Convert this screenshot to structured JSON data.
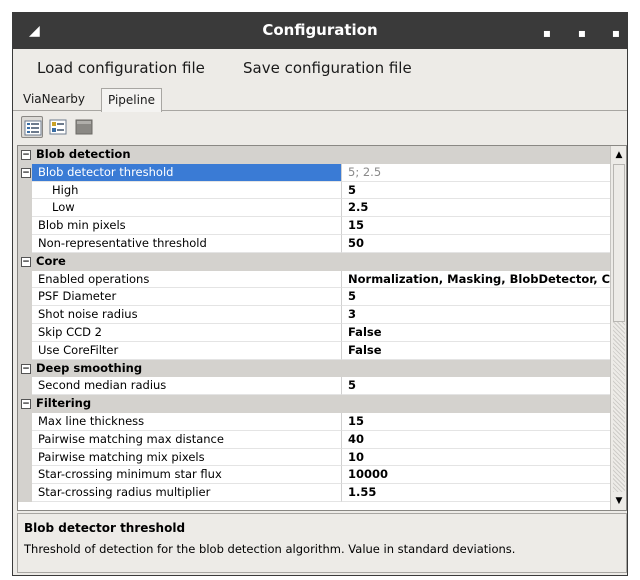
{
  "window": {
    "title": "Configuration",
    "menu_glyph": "◢",
    "min_glyph": "▪",
    "max_glyph": "▪",
    "close_glyph": "▪"
  },
  "menubar": {
    "load_label": "Load configuration file",
    "save_label": "Save configuration file"
  },
  "tabs": [
    {
      "label": "ViaNearby"
    },
    {
      "label": "Pipeline",
      "active": true
    }
  ],
  "toolbar": {
    "buttons": [
      {
        "icon": "categorized-icon",
        "active": true
      },
      {
        "icon": "alphabetical-icon",
        "active": false
      },
      {
        "icon": "property-pages-icon",
        "active": false
      }
    ]
  },
  "expander_glyph": "−",
  "grid": {
    "rows": [
      {
        "kind": "category",
        "label": "Blob detection"
      },
      {
        "kind": "property",
        "label": "Blob detector threshold",
        "value": "5; 2.5",
        "selected": true,
        "expandable": true
      },
      {
        "kind": "property",
        "label": "High",
        "value": "5",
        "indent": true
      },
      {
        "kind": "property",
        "label": "Low",
        "value": "2.5",
        "indent": true
      },
      {
        "kind": "property",
        "label": "Blob min pixels",
        "value": "15"
      },
      {
        "kind": "property",
        "label": "Non-representative threshold",
        "value": "50"
      },
      {
        "kind": "category",
        "label": "Core"
      },
      {
        "kind": "property",
        "label": "Enabled operations",
        "value": "Normalization, Masking, BlobDetector, C"
      },
      {
        "kind": "property",
        "label": "PSF Diameter",
        "value": "5"
      },
      {
        "kind": "property",
        "label": "Shot noise radius",
        "value": "3"
      },
      {
        "kind": "property",
        "label": "Skip CCD 2",
        "value": "False"
      },
      {
        "kind": "property",
        "label": "Use CoreFilter",
        "value": "False"
      },
      {
        "kind": "category",
        "label": "Deep smoothing"
      },
      {
        "kind": "property",
        "label": "Second median radius",
        "value": "5"
      },
      {
        "kind": "category",
        "label": "Filtering"
      },
      {
        "kind": "property",
        "label": "Max line thickness",
        "value": "15"
      },
      {
        "kind": "property",
        "label": "Pairwise matching max distance",
        "value": "40"
      },
      {
        "kind": "property",
        "label": "Pairwise matching mix pixels",
        "value": "10"
      },
      {
        "kind": "property",
        "label": "Star-crossing minimum star flux",
        "value": "10000"
      },
      {
        "kind": "property",
        "label": "Star-crossing radius multiplier",
        "value": "1.55"
      }
    ]
  },
  "scrollbar": {
    "up_glyph": "▲",
    "down_glyph": "▼"
  },
  "description": {
    "title": "Blob detector threshold",
    "text": "Threshold of detection for the blob detection algorithm. Value in standard deviations."
  },
  "colors": {
    "selection": "#3a7bd5",
    "titlebar": "#3a3a3a",
    "category_row": "#d4d2ce"
  }
}
